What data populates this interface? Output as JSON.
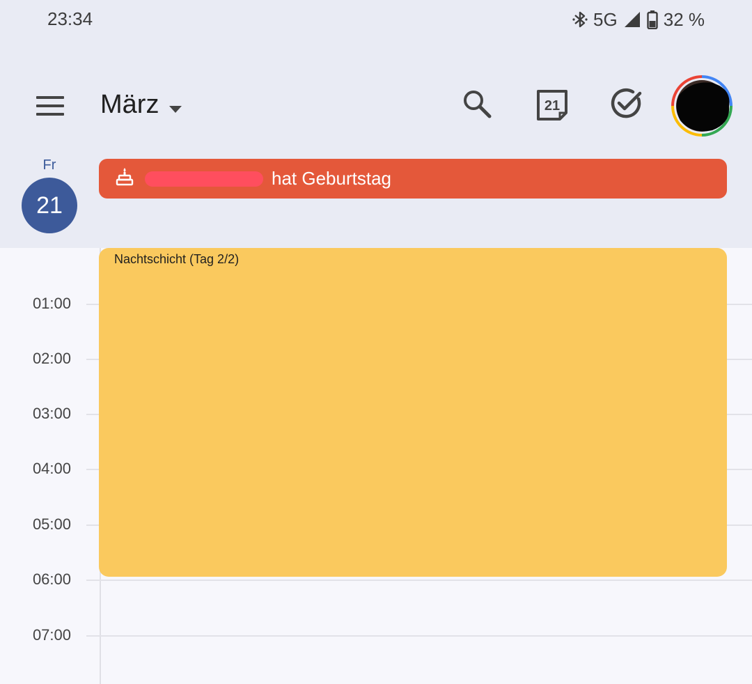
{
  "status_bar": {
    "time": "23:34",
    "network": "5G",
    "battery": "32 %",
    "icons": [
      "bluetooth-icon",
      "signal-icon",
      "battery-icon"
    ]
  },
  "app_bar": {
    "month": "März",
    "today_number": "21",
    "icons": [
      "menu-icon",
      "dropdown-caret-icon",
      "search-icon",
      "today-calendar-icon",
      "tasks-check-icon",
      "account-avatar"
    ]
  },
  "day_header": {
    "weekday": "Fr",
    "date": "21"
  },
  "all_day_event": {
    "text": "hat Geburtstag",
    "color": "#e4583a"
  },
  "timed_event": {
    "title": "Nachtschicht (Tag 2/2)",
    "color": "#fac95e"
  },
  "hours": [
    "01:00",
    "02:00",
    "03:00",
    "04:00",
    "05:00",
    "06:00",
    "07:00"
  ],
  "colors": {
    "header_bg": "#e9ebf4",
    "today_circle": "#3d5a9a"
  }
}
